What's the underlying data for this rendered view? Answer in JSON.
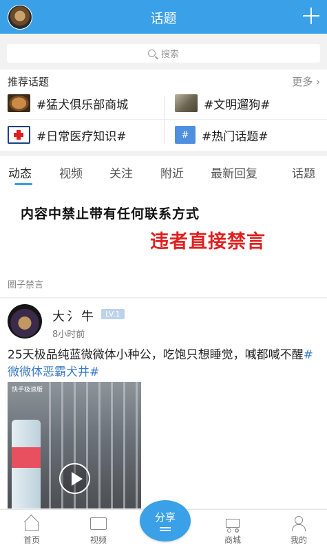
{
  "header": {
    "title": "话题"
  },
  "search": {
    "placeholder": "搜索"
  },
  "recommended": {
    "heading": "推荐话题",
    "more": "更多",
    "topics": [
      {
        "label": "#猛犬俱乐部商城"
      },
      {
        "label": "#文明遛狗#"
      },
      {
        "label": "#日常医疗知识#"
      },
      {
        "label": "#热门话题#"
      }
    ]
  },
  "tabs": [
    "动态",
    "视频",
    "关注",
    "附近",
    "最新回复",
    "话题"
  ],
  "notice": {
    "line1": "内容中禁止带有任何联系方式",
    "line2": "违者直接禁言",
    "tag": "圈子禁言"
  },
  "post": {
    "author": "大氵牛",
    "level": "LV.1",
    "time": "8小时前",
    "text": "25天极品纯蓝微微体小种公，吃饱只想睡觉，喊都喊不醒",
    "hashtag": "#微微体恶霸犬井#",
    "video_watermark": "快手极速版"
  },
  "bottom_nav": {
    "home": "首页",
    "video": "视频",
    "share": "分享",
    "shop": "商城",
    "mine": "我的"
  },
  "colors": {
    "accent": "#3aa0e8",
    "warning_red": "#e02020",
    "hashtag_blue": "#3b7cc4"
  }
}
